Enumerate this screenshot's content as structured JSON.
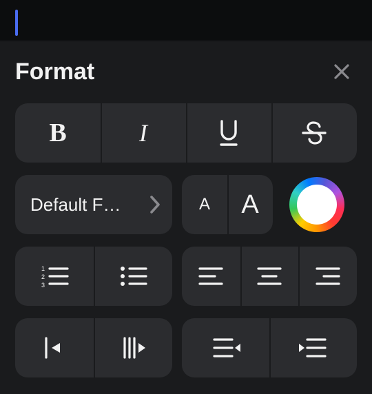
{
  "panel": {
    "title": "Format"
  },
  "styles": {
    "bold": "B",
    "italic": "I"
  },
  "font": {
    "selected_label": "Default F…",
    "size_small": "A",
    "size_large": "A"
  },
  "color": {
    "current": "#ffffff"
  },
  "icons": {
    "close": "close",
    "chevron": "chevron-right",
    "underline": "underline",
    "strike": "strikethrough",
    "numbered_list": "numbered-list",
    "bulleted_list": "bulleted-list",
    "align_left": "align-left",
    "align_center": "align-center",
    "align_right": "align-right",
    "indent_decrease": "indent-decrease",
    "indent_increase": "indent-increase",
    "direction_rtl": "text-direction-rtl",
    "direction_ltr": "text-direction-ltr"
  }
}
